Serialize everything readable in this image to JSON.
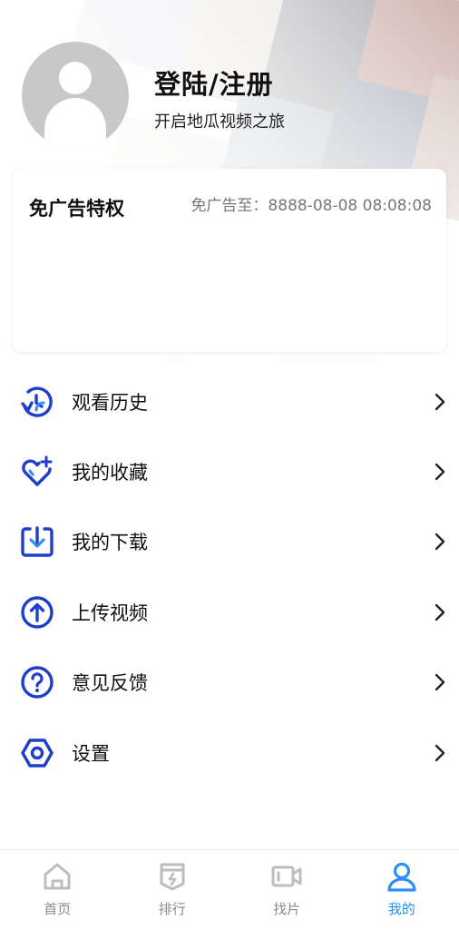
{
  "profile": {
    "login_title": "登陆/注册",
    "subtitle": "开启地瓜视频之旅"
  },
  "vip": {
    "title": "免广告特权",
    "expire": "免广告至：8888-08-08 08:08:08"
  },
  "menu": {
    "items": [
      {
        "label": "观看历史",
        "icon": "history-icon"
      },
      {
        "label": "我的收藏",
        "icon": "favorite-heart-icon"
      },
      {
        "label": "我的下载",
        "icon": "download-icon"
      },
      {
        "label": "上传视频",
        "icon": "upload-icon"
      },
      {
        "label": "意见反馈",
        "icon": "feedback-question-icon"
      },
      {
        "label": "设置",
        "icon": "settings-hexagon-icon"
      }
    ]
  },
  "tabbar": {
    "tabs": [
      {
        "label": "首页",
        "icon": "home-icon",
        "active": false
      },
      {
        "label": "排行",
        "icon": "ranking-icon",
        "active": false
      },
      {
        "label": "找片",
        "icon": "video-camera-icon",
        "active": false
      },
      {
        "label": "我的",
        "icon": "user-icon",
        "active": true
      }
    ]
  },
  "colors": {
    "accent_icon": "#1f3fc8",
    "active_tab": "#2f8ef5",
    "inactive_tab": "#bdbdbd"
  }
}
